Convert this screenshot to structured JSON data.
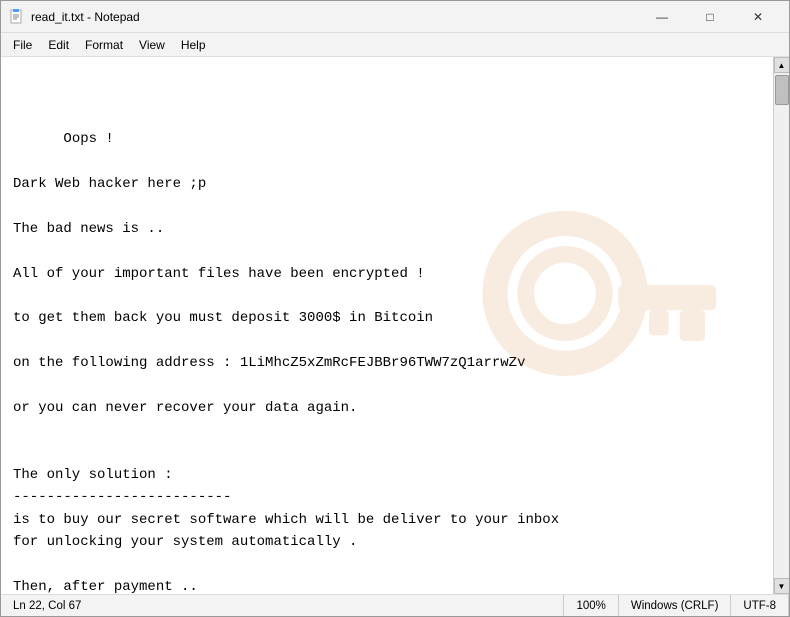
{
  "window": {
    "title": "read_it.txt - Notepad",
    "icon": "notepad-icon"
  },
  "titlebar": {
    "minimize_label": "—",
    "maximize_label": "□",
    "close_label": "✕"
  },
  "menu": {
    "items": [
      {
        "label": "File",
        "id": "file"
      },
      {
        "label": "Edit",
        "id": "edit"
      },
      {
        "label": "Format",
        "id": "format"
      },
      {
        "label": "View",
        "id": "view"
      },
      {
        "label": "Help",
        "id": "help"
      }
    ]
  },
  "content": {
    "text": "Oops !\n\nDark Web hacker here ;p\n\nThe bad news is ..\n\nAll of your important files have been encrypted !\n\nto get them back you must deposit 3000$ in Bitcoin\n\non the following address : 1LiMhcZ5xZmRcFEJBBr96TWW7zQ1arrwZv\n\nor you can never recover your data again.\n\n\nThe only solution :\n--------------------------\nis to buy our secret software which will be deliver to your inbox\nfor unlocking your system automatically .\n\nThen, after payment ..\nsend a mail asking us to deliver our software : anonymoux@dnmx.org"
  },
  "statusbar": {
    "line": "Ln 22, Col 67",
    "zoom": "100%",
    "line_ending": "Windows (CRLF)",
    "encoding": "UTF-8"
  }
}
